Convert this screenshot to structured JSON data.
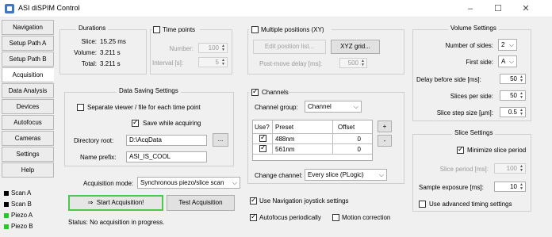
{
  "window": {
    "title": "ASI diSPIM Control",
    "icon": "app-icon",
    "controls": [
      "–",
      "☐",
      "✕"
    ]
  },
  "nav": {
    "items": [
      {
        "label": "Navigation"
      },
      {
        "label": "Setup Path A"
      },
      {
        "label": "Setup Path B"
      },
      {
        "label": "Acquisition"
      },
      {
        "label": "Data Analysis"
      },
      {
        "label": "Devices"
      },
      {
        "label": "Autofocus"
      },
      {
        "label": "Cameras"
      },
      {
        "label": "Settings"
      },
      {
        "label": "Help"
      }
    ],
    "active": "Acquisition",
    "indicators": [
      {
        "label": "Scan A",
        "color": "#000000"
      },
      {
        "label": "Scan B",
        "color": "#000000"
      },
      {
        "label": "Piezo A",
        "color": "#22cc22"
      },
      {
        "label": "Piezo B",
        "color": "#22cc22"
      }
    ]
  },
  "durations": {
    "title": "Durations",
    "slice_label": "Slice:",
    "slice_value": "15.25 ms",
    "volume_label": "Volume:",
    "volume_value": "3.211 s",
    "total_label": "Total:",
    "total_value": "3.211 s"
  },
  "timepoints": {
    "title": "Time points",
    "checked": false,
    "number_label": "Number:",
    "number_value": "100",
    "interval_label": "Interval [s]:",
    "interval_value": "5"
  },
  "positions": {
    "title": "Multiple positions (XY)",
    "checked": false,
    "edit_label": "Edit position list...",
    "grid_label": "XYZ grid...",
    "delay_label": "Post-move delay [ms]:",
    "delay_value": "500"
  },
  "data_saving": {
    "title": "Data Saving Settings",
    "separate_label": "Separate viewer / file for each time point",
    "separate_checked": false,
    "save_label": "Save while acquiring",
    "save_checked": true,
    "dir_label": "Directory root:",
    "dir_value": "D:\\AcqData",
    "browse_label": "...",
    "prefix_label": "Name prefix:",
    "prefix_value": "ASI_IS_COOL"
  },
  "channels": {
    "title": "Channels",
    "checked": true,
    "group_label": "Channel group:",
    "group_value": "Channel",
    "headers": [
      "Use?",
      "Preset",
      "Offset"
    ],
    "rows": [
      {
        "use": true,
        "preset": "488nm",
        "offset": "0"
      },
      {
        "use": true,
        "preset": "561nm",
        "offset": "0"
      }
    ],
    "add_label": "+",
    "remove_label": "-",
    "change_label": "Change channel:",
    "change_value": "Every slice (PLogic)"
  },
  "volume": {
    "title": "Volume Settings",
    "sides_label": "Number of sides:",
    "sides_value": "2",
    "first_label": "First side:",
    "first_value": "A",
    "delay_label": "Delay before side [ms]:",
    "delay_value": "50",
    "slices_label": "Slices per side:",
    "slices_value": "50",
    "step_label": "Slice step size [µm]:",
    "step_value": "0.5"
  },
  "slice": {
    "title": "Slice Settings",
    "minimize_label": "Minimize slice period",
    "minimize_checked": true,
    "period_label": "Slice period [ms]:",
    "period_value": "100",
    "exposure_label": "Sample exposure [ms]:",
    "exposure_value": "10",
    "advanced_label": "Use advanced timing settings",
    "advanced_checked": false
  },
  "acquisition": {
    "mode_label": "Acquisition mode:",
    "mode_value": "Synchronous piezo/slice scan",
    "start_label": "Start Acquisition!",
    "start_icon": "⇒",
    "test_label": "Test Acquisition",
    "status": "Status: No acquisition in progress."
  },
  "options": {
    "joystick_label": "Use Navigation joystick settings",
    "joystick_checked": true,
    "autofocus_label": "Autofocus periodically",
    "autofocus_checked": true,
    "motion_label": "Motion correction",
    "motion_checked": false
  }
}
